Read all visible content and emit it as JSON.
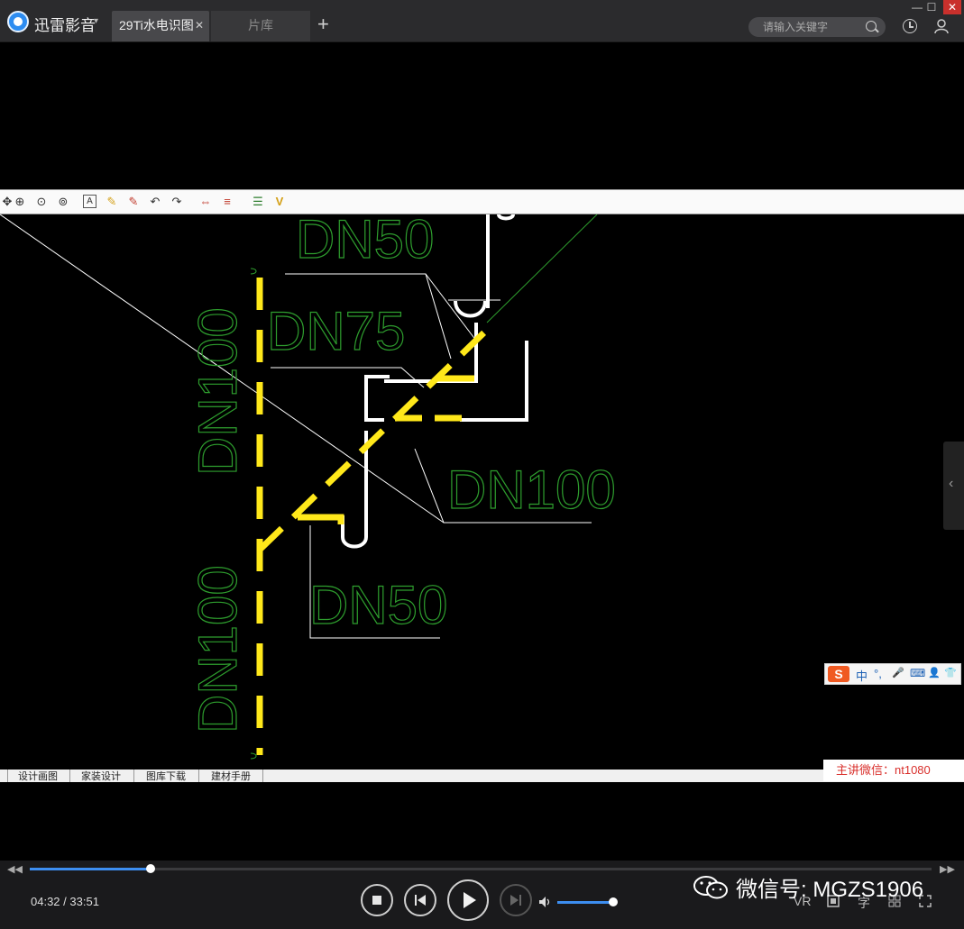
{
  "app": {
    "name": "迅雷影音",
    "menu_caret": "▾"
  },
  "tabs": [
    {
      "label": "29Ti水电识图",
      "active": true,
      "close": "✕"
    },
    {
      "label": "片库",
      "active": false
    }
  ],
  "new_tab": "+",
  "search": {
    "placeholder": "请输入关键字"
  },
  "window_buttons": {
    "minimize": "—",
    "maximize": "☐",
    "close": "✕"
  },
  "cad": {
    "labels": {
      "dn50_top": "DN50",
      "dn75": "DN75",
      "dn100_right": "DN100",
      "dn50_bottom": "DN50",
      "dn100_v_top": "DN100",
      "dn100_v_bottom": "DN100"
    },
    "bottom_tabs": [
      "设计画图",
      "家装设计",
      "图库下载",
      "建材手册"
    ],
    "toolbar_glyphs": {
      "text_tool": "A",
      "layer_check": "V"
    }
  },
  "ime": {
    "logo": "S",
    "items": [
      "中",
      "°,",
      "🎤",
      "⌨",
      "👤",
      "👕"
    ]
  },
  "overlay_label": "主讲微信：nt1080",
  "side_handle": "‹",
  "player": {
    "current_time": "04:32",
    "total_time": "33:51",
    "time_separator": " / ",
    "progress_fraction": 0.134,
    "volume_fraction": 1.0,
    "skip_back": "◀◀",
    "skip_forward": "▶▶",
    "extra_buttons": [
      "VR",
      "字"
    ]
  },
  "watermark": "微信号: MGZS1906",
  "colors": {
    "cad_green": "#2e9e2e",
    "pipe_yellow": "#ffe81a",
    "accent": "#3d8ef0",
    "label_red": "#d9302c"
  }
}
